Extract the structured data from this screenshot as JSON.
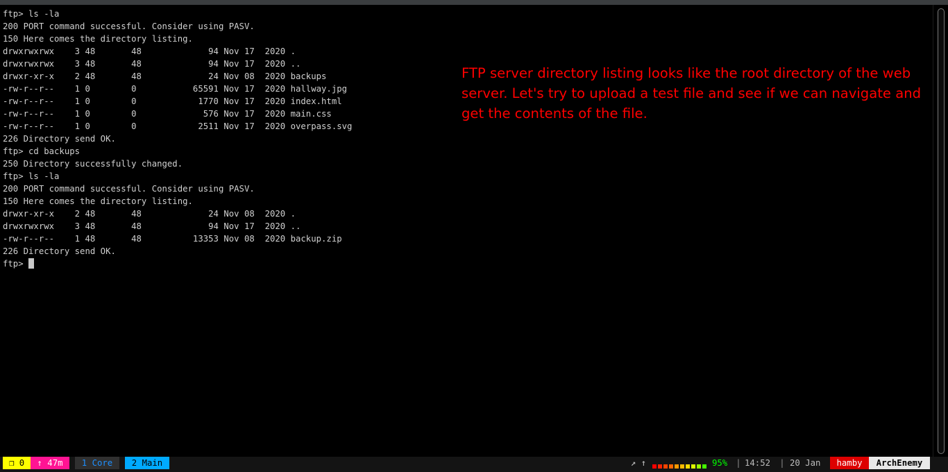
{
  "terminal": {
    "lines": [
      "ftp> ls -la",
      "200 PORT command successful. Consider using PASV.",
      "150 Here comes the directory listing.",
      "drwxrwxrwx    3 48       48             94 Nov 17  2020 .",
      "drwxrwxrwx    3 48       48             94 Nov 17  2020 ..",
      "drwxr-xr-x    2 48       48             24 Nov 08  2020 backups",
      "-rw-r--r--    1 0        0           65591 Nov 17  2020 hallway.jpg",
      "-rw-r--r--    1 0        0            1770 Nov 17  2020 index.html",
      "-rw-r--r--    1 0        0             576 Nov 17  2020 main.css",
      "-rw-r--r--    1 0        0            2511 Nov 17  2020 overpass.svg",
      "226 Directory send OK.",
      "ftp> cd backups",
      "250 Directory successfully changed.",
      "ftp> ls -la",
      "200 PORT command successful. Consider using PASV.",
      "150 Here comes the directory listing.",
      "drwxr-xr-x    2 48       48             24 Nov 08  2020 .",
      "drwxrwxrwx    3 48       48             94 Nov 17  2020 ..",
      "-rw-r--r--    1 48       48          13353 Nov 08  2020 backup.zip",
      "226 Directory send OK."
    ],
    "prompt": "ftp> "
  },
  "annotation": {
    "text": "FTP server directory listing looks like the root directory of the web server. Let's try to upload a test file and see if we can navigate and get the contents of the file.",
    "color": "#ff0000"
  },
  "statusbar": {
    "sessions": "❐ 0",
    "uptime": "↑ 47m",
    "window1": "1 Core",
    "window2": "2 Main",
    "arrows": "↗ ↑",
    "battery_meter": {
      "level": 0.95,
      "colors": [
        "#ff0000",
        "#ff2200",
        "#ff4400",
        "#ff6600",
        "#ff9900",
        "#ffbb00",
        "#ffdd00",
        "#ddff00",
        "#99ff00",
        "#44ff00"
      ]
    },
    "battery_percent": "95%",
    "sep": "|",
    "time": "14:52",
    "date": "20 Jan",
    "user": "hamby",
    "host": "ArchEnemy"
  }
}
